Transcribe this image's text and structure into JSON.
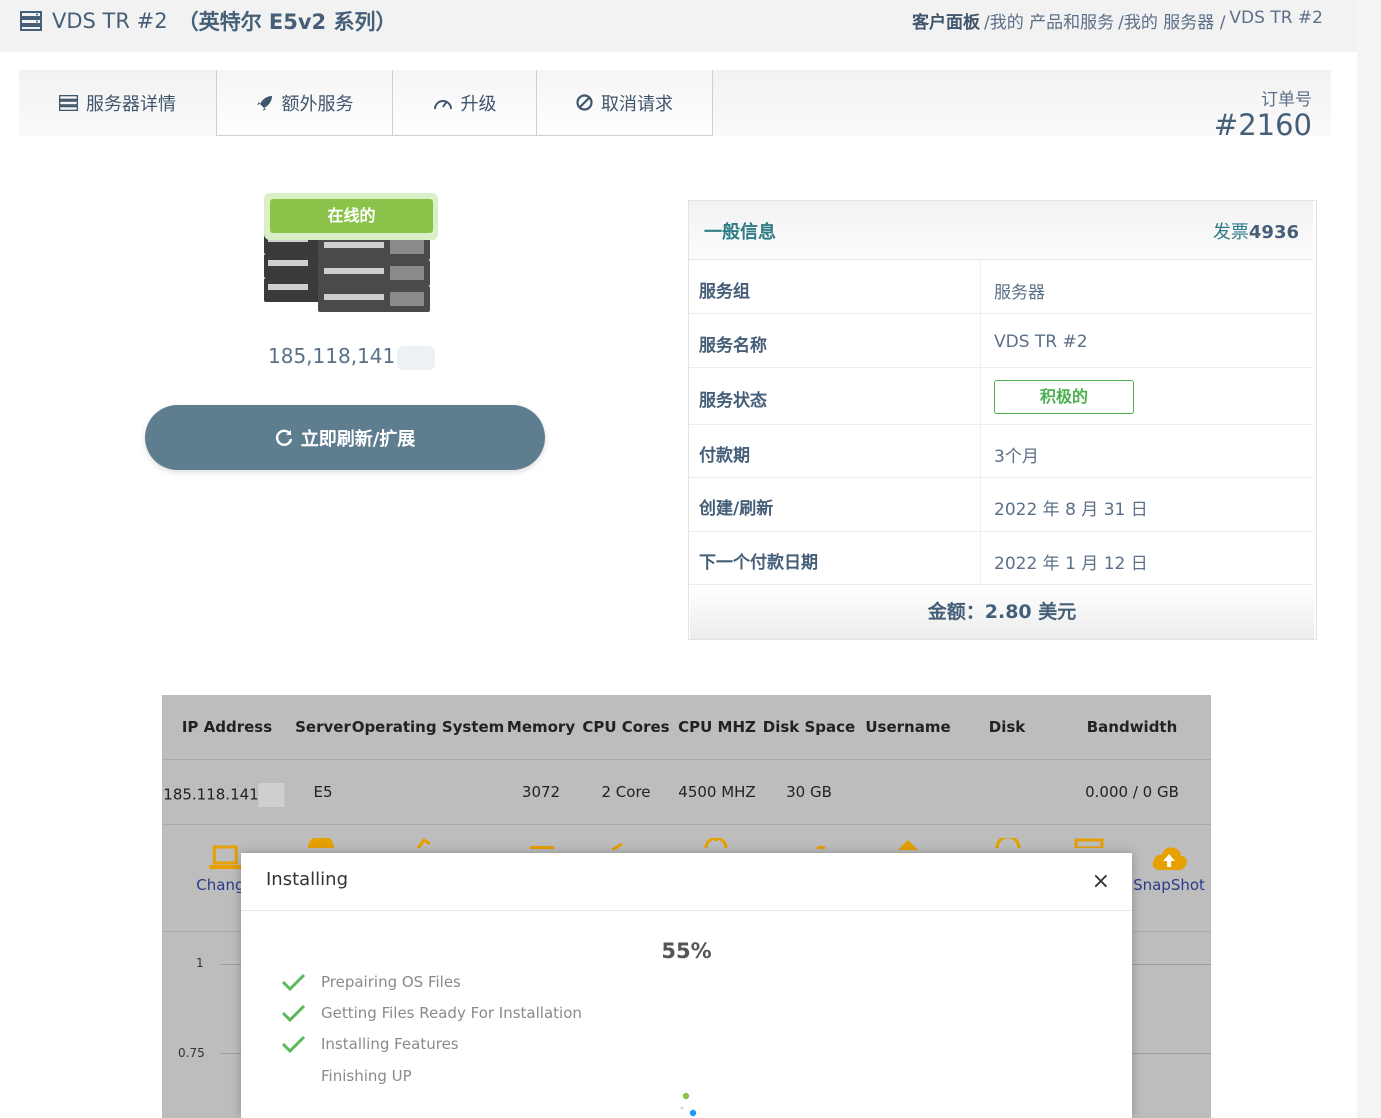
{
  "header": {
    "title_main": "VDS TR #2",
    "title_suffix": "（英特尔 E5v2 系列）",
    "breadcrumb": [
      {
        "label": "客户面板",
        "strong": true
      },
      {
        "label": "/我的 产品和服务"
      },
      {
        "label": "/我的 服务器 /"
      },
      {
        "label": "VDS TR #2"
      }
    ]
  },
  "tabs": [
    {
      "label": "服务器详情",
      "icon": "server-icon"
    },
    {
      "label": "额外服务",
      "icon": "rocket-icon"
    },
    {
      "label": "升级",
      "icon": "gauge-icon"
    },
    {
      "label": "取消请求",
      "icon": "ban-icon"
    }
  ],
  "order": {
    "label": "订单号",
    "number": "#2160"
  },
  "server": {
    "status_badge": "在线的",
    "ip": "185,118,141",
    "renew_button": "立即刷新/扩展"
  },
  "info": {
    "title": "一般信息",
    "invoice_prefix": "发票",
    "invoice_number": "4936",
    "rows": [
      {
        "key": "服务组",
        "value": "服务器"
      },
      {
        "key": "服务名称",
        "value": "VDS TR #2"
      },
      {
        "key": "服务状态",
        "value": "积极的",
        "badge": true
      },
      {
        "key": "付款期",
        "value": "3个月"
      },
      {
        "key": "创建/刷新",
        "value": "2022 年 8 月 31 日"
      },
      {
        "key": "下一个付款日期",
        "value": "2022 年 1 月 12 日"
      }
    ],
    "total": "金额：2.80 美元"
  },
  "vds_table": {
    "headers": [
      "IP Address",
      "Server",
      "Operating System",
      "Memory",
      "CPU Cores",
      "CPU MHZ",
      "Disk Space",
      "Username",
      "Disk",
      "Bandwidth"
    ],
    "row": {
      "ip": "185.118.141",
      "server": "E5",
      "os": "",
      "memory": "3072",
      "cpu_cores": "2 Core",
      "cpu_mhz": "4500 MHZ",
      "disk_space": "30 GB",
      "username": "",
      "disk": "",
      "bandwidth": "0.000 / 0 GB"
    },
    "actions": [
      {
        "label": "Change",
        "icon": "laptop-icon"
      },
      {
        "label": "SnapShot",
        "icon": "cloud-upload-icon"
      }
    ],
    "accent_color": "#e6a000",
    "chart_ticks": [
      "1",
      "0.75"
    ]
  },
  "modal": {
    "title": "Installing",
    "close": "×",
    "progress": 55,
    "progress_text": "55%",
    "steps": [
      {
        "label": "Prepairing OS Files",
        "done": true
      },
      {
        "label": "Getting Files Ready For Installation",
        "done": true
      },
      {
        "label": "Installing Features",
        "done": true
      },
      {
        "label": "Finishing UP",
        "done": false
      }
    ]
  }
}
